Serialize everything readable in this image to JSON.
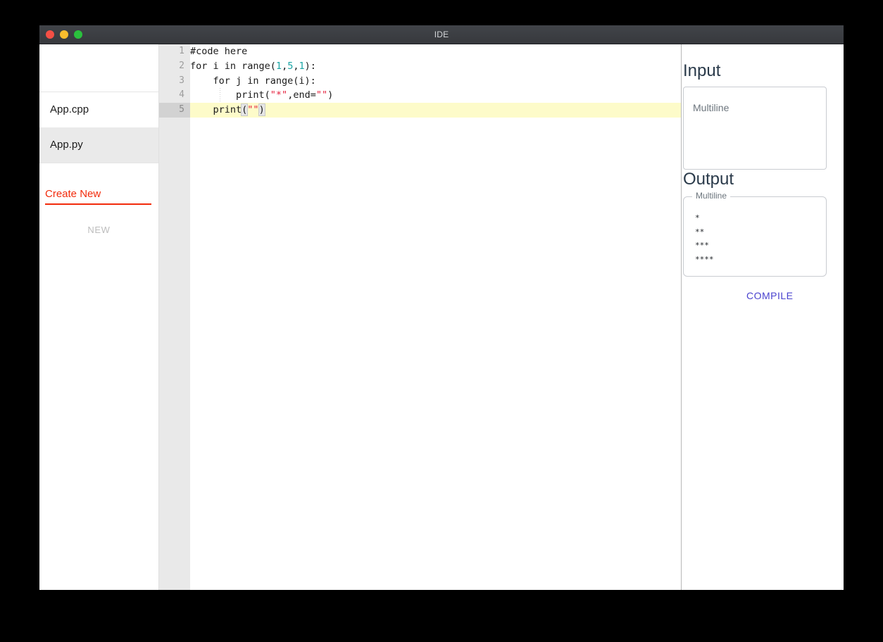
{
  "window": {
    "title": "IDE",
    "traffic_lights": [
      {
        "name": "close",
        "color": "#f44f45"
      },
      {
        "name": "minimize",
        "color": "#f9bc2d"
      },
      {
        "name": "zoom",
        "color": "#2ac13d"
      }
    ]
  },
  "sidebar": {
    "files": [
      {
        "label": "App.cpp",
        "selected": false
      },
      {
        "label": "App.py",
        "selected": true
      }
    ],
    "create_new_label": "Create New",
    "new_button_label": "NEW"
  },
  "editor": {
    "line_numbers": [
      "1",
      "2",
      "3",
      "4",
      "5"
    ],
    "active_line": 5,
    "lines": [
      {
        "n": "1",
        "text": "#code here"
      },
      {
        "n": "2",
        "text": "for i in range(1,5,1):"
      },
      {
        "n": "3",
        "text": "    for j in range(i):"
      },
      {
        "n": "4",
        "text": "        print(\"*\",end=\"\")"
      },
      {
        "n": "5",
        "text": "    print(\"\")"
      }
    ],
    "line1_text": "#code here",
    "line2_before": "for i in range(",
    "line2_n1": "1",
    "line2_c1": ",",
    "line2_n2": "5",
    "line2_c2": ",",
    "line2_n3": "1",
    "line2_after": "):",
    "line3_text": "    for j in range(i):",
    "line4_before": "        print(",
    "line4_str1": "\"*\"",
    "line4_mid": ",end=",
    "line4_str2": "\"\"",
    "line4_after": ")",
    "line5_before": "    print",
    "line5_open": "(",
    "line5_str": "\"\"",
    "line5_close": ")",
    "colors": {
      "number": "#1aa5a5",
      "string": "#e5203d",
      "text": "#1a1a1a",
      "active_line_bg": "#fdfbc9",
      "gutter_bg": "#e9e9e9"
    }
  },
  "panel": {
    "input_title": "Input",
    "input_placeholder": "Multiline",
    "input_value": "",
    "output_title": "Output",
    "output_legend": "Multiline",
    "output_lines": [
      "*",
      "**",
      "***",
      "****"
    ],
    "compile_label": "COMPILE",
    "compile_color": "#4a43cf"
  }
}
